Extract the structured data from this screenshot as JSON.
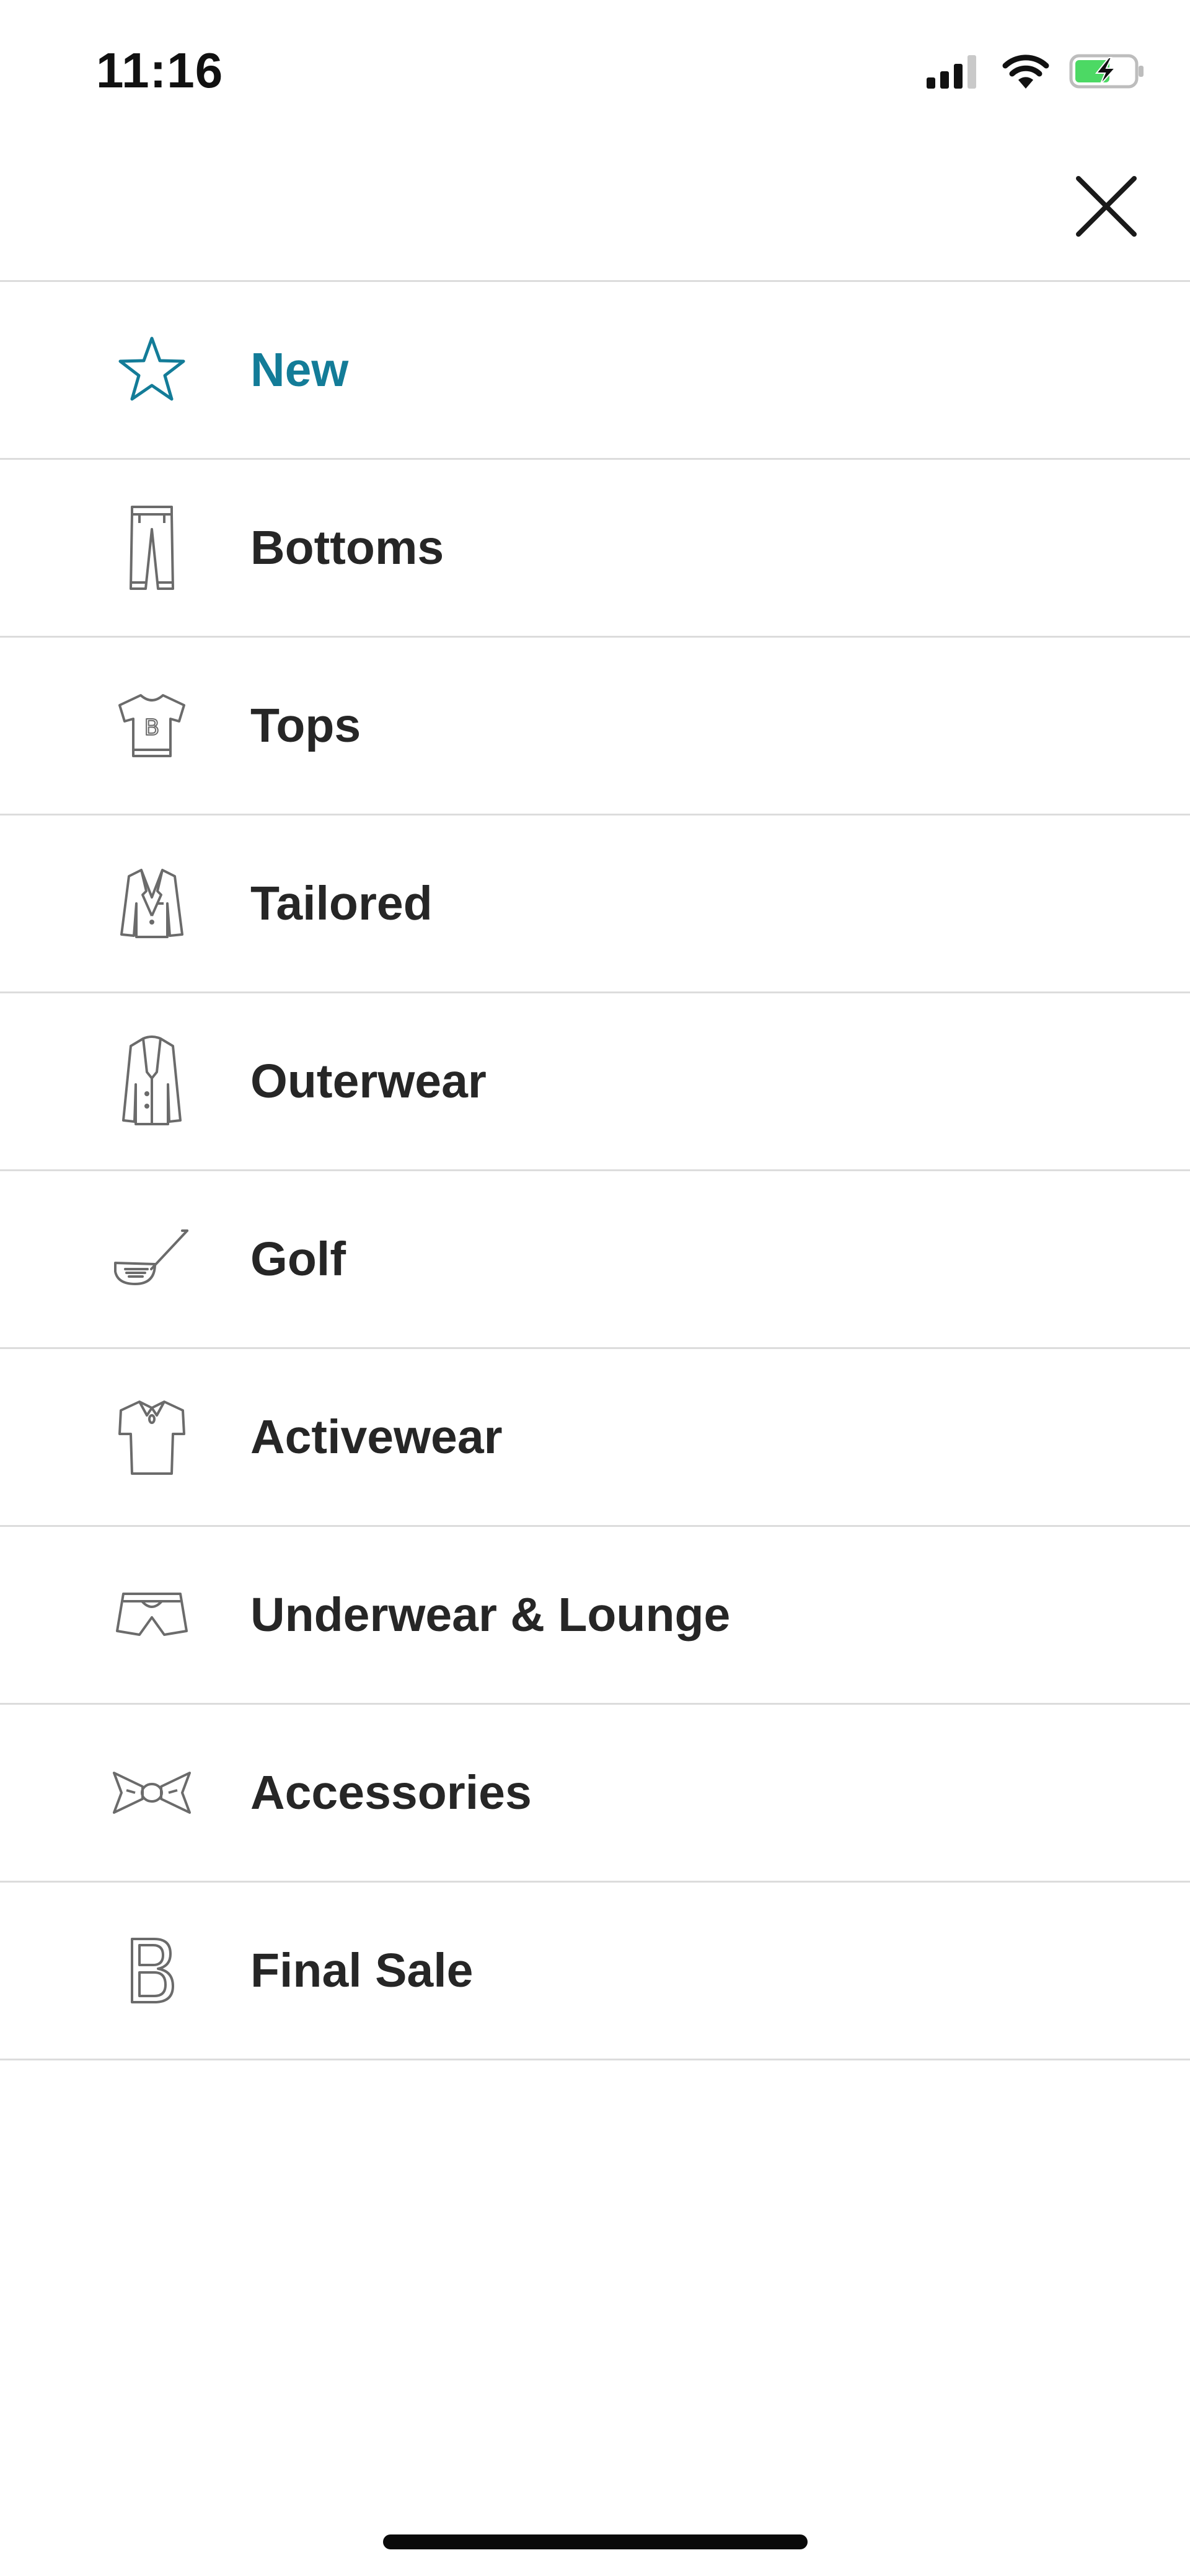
{
  "status_bar": {
    "time": "11:16"
  },
  "colors": {
    "accent": "#137c98",
    "text": "#262626",
    "divider": "#dcdcdc",
    "battery_green": "#4cd964"
  },
  "close_button": {
    "icon": "close-icon"
  },
  "menu": {
    "items": [
      {
        "label": "New",
        "icon": "star-icon",
        "active": true
      },
      {
        "label": "Bottoms",
        "icon": "pants-icon",
        "active": false
      },
      {
        "label": "Tops",
        "icon": "tshirt-icon",
        "active": false
      },
      {
        "label": "Tailored",
        "icon": "blazer-icon",
        "active": false
      },
      {
        "label": "Outerwear",
        "icon": "coat-icon",
        "active": false
      },
      {
        "label": "Golf",
        "icon": "golf-club-icon",
        "active": false
      },
      {
        "label": "Activewear",
        "icon": "polo-shirt-icon",
        "active": false
      },
      {
        "label": "Underwear & Lounge",
        "icon": "boxers-icon",
        "active": false
      },
      {
        "label": "Accessories",
        "icon": "bow-tie-icon",
        "active": false
      },
      {
        "label": "Final Sale",
        "icon": "brand-b-icon",
        "active": false
      }
    ]
  }
}
